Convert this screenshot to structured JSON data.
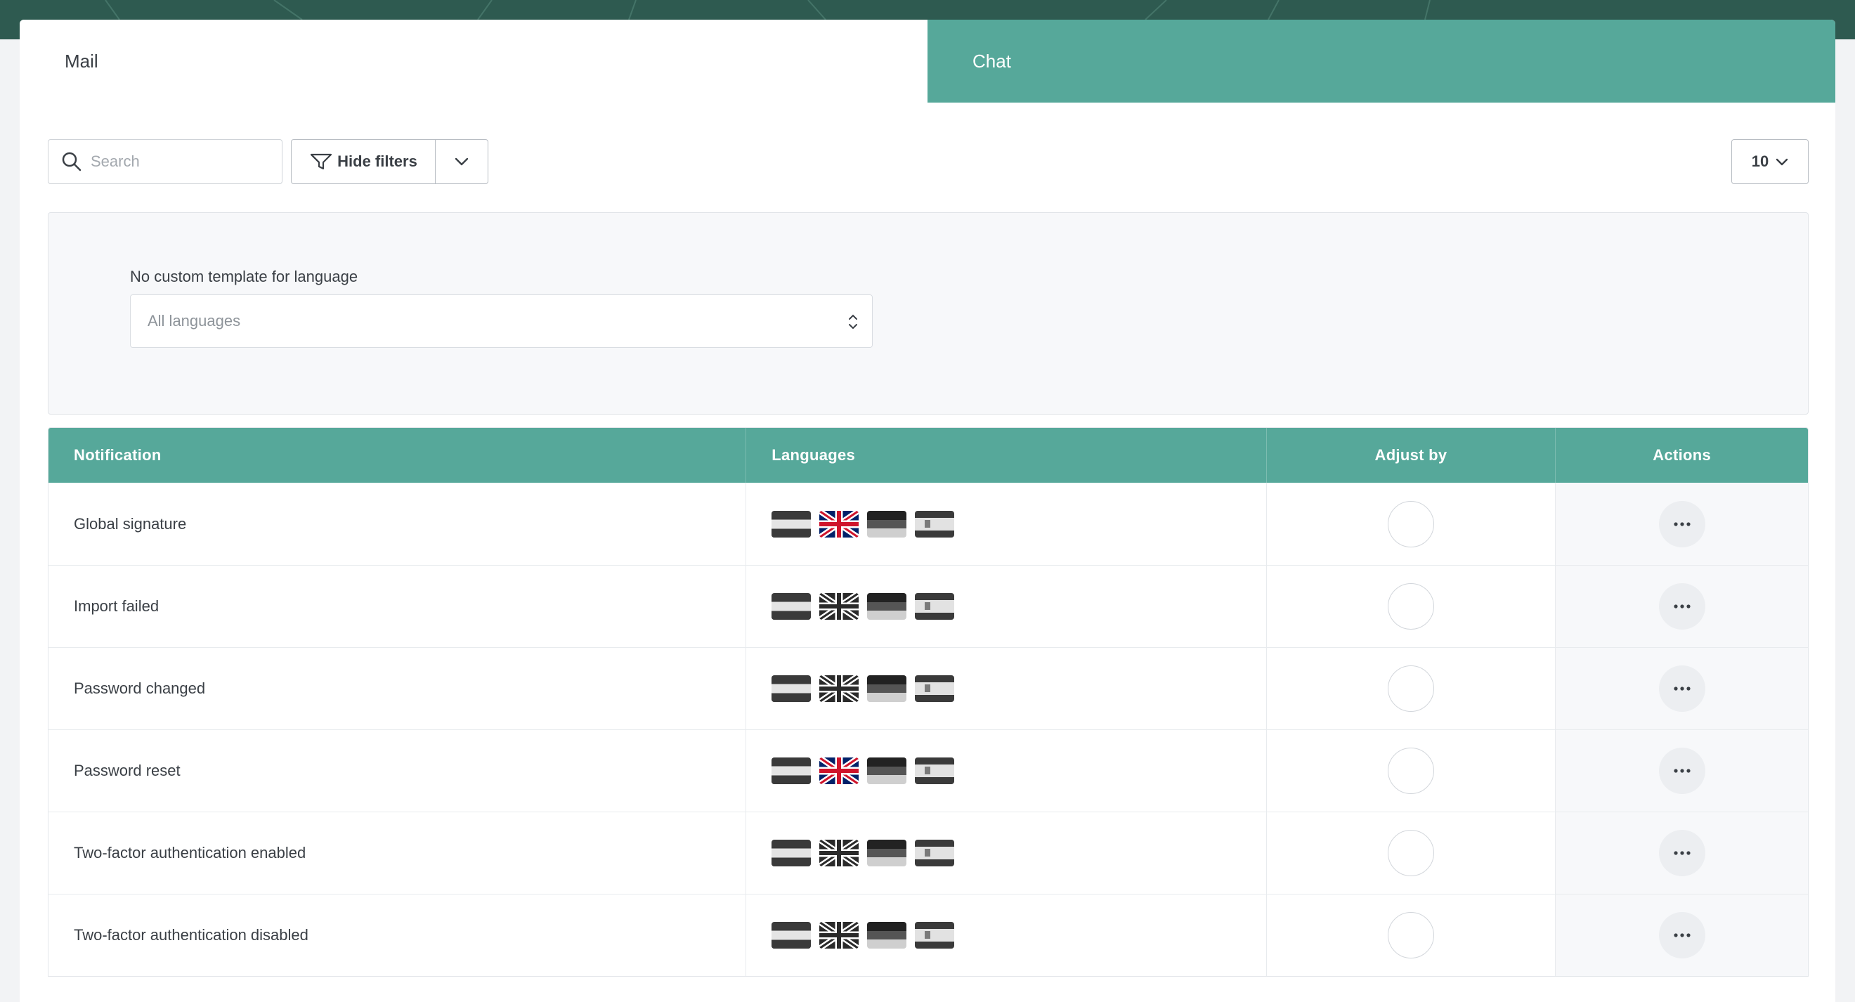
{
  "tabs": [
    {
      "label": "Mail",
      "active": true
    },
    {
      "label": "Chat",
      "active": false
    }
  ],
  "toolbar": {
    "search_placeholder": "Search",
    "filters_label": "Hide filters",
    "per_page": "10"
  },
  "filters": {
    "language_label": "No custom template for language",
    "language_value": "All languages"
  },
  "table": {
    "headers": {
      "notification": "Notification",
      "languages": "Languages",
      "adjust_by": "Adjust by",
      "actions": "Actions"
    },
    "rows": [
      {
        "notification": "Global signature",
        "uk_flag_colored": true
      },
      {
        "notification": "Import failed",
        "uk_flag_colored": false
      },
      {
        "notification": "Password changed",
        "uk_flag_colored": false
      },
      {
        "notification": "Password reset",
        "uk_flag_colored": true
      },
      {
        "notification": "Two-factor authentication enabled",
        "uk_flag_colored": false
      },
      {
        "notification": "Two-factor authentication disabled",
        "uk_flag_colored": false
      }
    ]
  },
  "colors": {
    "brand_teal": "#56a89a",
    "header_dark": "#2e5a50",
    "uk_red": "#cf142b",
    "uk_blue": "#012169"
  }
}
